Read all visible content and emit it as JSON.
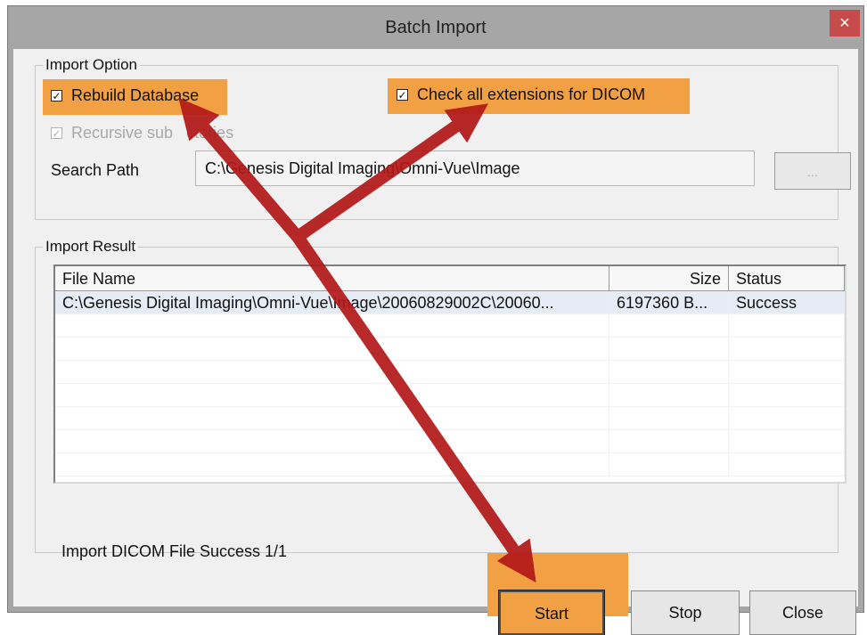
{
  "window": {
    "title": "Batch Import",
    "close_glyph": "×"
  },
  "import_option": {
    "legend": "Import Option",
    "rebuild_database": {
      "label": "Rebuild Database",
      "checked": true
    },
    "check_all_extensions": {
      "label": "Check all extensions for DICOM",
      "checked": true
    },
    "recursive": {
      "label": "Recursive sub   ctories",
      "checked": true,
      "disabled": true
    },
    "search_path_label": "Search Path",
    "search_path_value": "C:\\Genesis Digital Imaging\\Omni-Vue\\Image",
    "browse_label": "..."
  },
  "import_result": {
    "legend": "Import Result",
    "columns": [
      "File Name",
      "Size",
      "Status"
    ],
    "rows": [
      {
        "file": "C:\\Genesis Digital Imaging\\Omni-Vue\\Image\\20060829002C\\20060...",
        "size": "6197360 B...",
        "status": "Success"
      }
    ],
    "status_text": "Import DICOM File Success 1/1"
  },
  "buttons": {
    "start": "Start",
    "stop": "Stop",
    "close": "Close"
  },
  "check_glyph": "✓",
  "colors": {
    "highlight": "#f2a044",
    "arrow": "#b21818",
    "title_bar": "#a6a6a6"
  }
}
